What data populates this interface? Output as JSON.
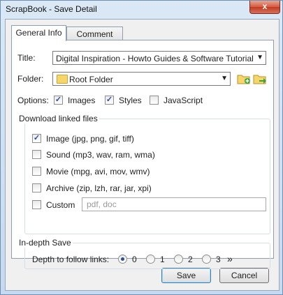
{
  "window": {
    "title": "ScrapBook - Save Detail",
    "close_label": "x"
  },
  "tabs": [
    {
      "label": "General Info",
      "active": true
    },
    {
      "label": "Comment",
      "active": false
    }
  ],
  "general": {
    "title_label": "Title:",
    "title_value": "Digital Inspiration - Howto Guides & Software Tutorial",
    "folder_label": "Folder:",
    "folder_value": "Root Folder",
    "options_label": "Options:",
    "options": [
      {
        "label": "Images",
        "checked": true
      },
      {
        "label": "Styles",
        "checked": true
      },
      {
        "label": "JavaScript",
        "checked": false
      }
    ]
  },
  "download": {
    "title": "Download linked files",
    "items": [
      {
        "label": "Image (jpg, png, gif, tiff)",
        "checked": true
      },
      {
        "label": "Sound (mp3, wav, ram, wma)",
        "checked": false
      },
      {
        "label": "Movie (mpg, avi, mov, wmv)",
        "checked": false
      },
      {
        "label": "Archive (zip, lzh, rar, jar, xpi)",
        "checked": false
      },
      {
        "label": "Custom",
        "checked": false
      }
    ],
    "custom_placeholder": "pdf, doc"
  },
  "indepth": {
    "title": "In-depth Save",
    "depth_label": "Depth to follow links:",
    "options": [
      {
        "label": "0",
        "selected": true
      },
      {
        "label": "1",
        "selected": false
      },
      {
        "label": "2",
        "selected": false
      },
      {
        "label": "3",
        "selected": false
      }
    ],
    "more_label": "»"
  },
  "buttons": {
    "save": "Save",
    "cancel": "Cancel"
  },
  "colors": {
    "folder": "#f6d66b",
    "add_arrow": "#3aa33a",
    "title_bar": "#dbe8f5"
  }
}
